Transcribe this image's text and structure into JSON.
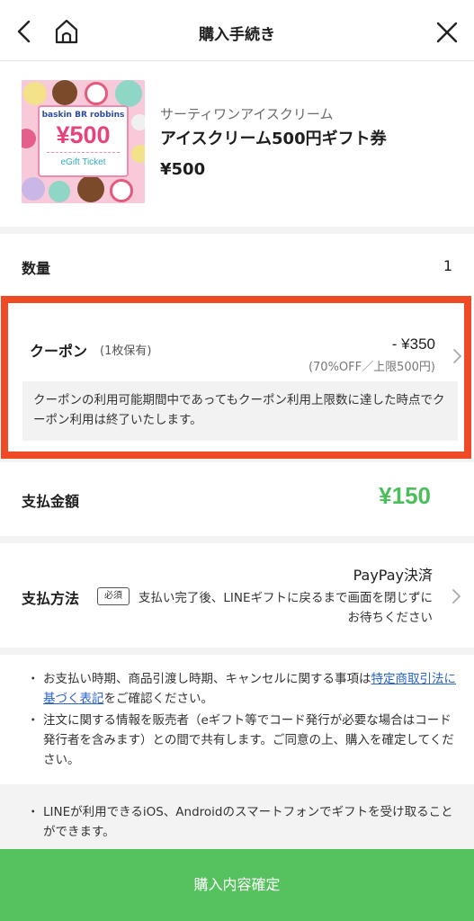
{
  "header": {
    "title": "購入手続き",
    "back_icon": "chevron-left",
    "home_icon": "home",
    "close_icon": "close"
  },
  "product": {
    "shop": "サーティワンアイスクリーム",
    "name": "アイスクリーム500円ギフト券",
    "price": "¥500",
    "thumbnail": {
      "brand": "baskin BR robbins",
      "price_text": "¥500",
      "label": "eGift Ticket"
    }
  },
  "quantity": {
    "label": "数量",
    "value": "1"
  },
  "coupon": {
    "label": "クーポン",
    "owned": "(1枚保有)",
    "discount": "- ¥350",
    "discount_note": "(70%OFF／上限500円)",
    "info": "クーポンの利用可能期間中であってもクーポン利用上限数に達した時点でクーポン利用は終了いたします。"
  },
  "total": {
    "label": "支払金額",
    "value": "¥150"
  },
  "payment": {
    "label": "支払方法",
    "required_badge": "必須",
    "method": "PayPay決済",
    "description": "支払い完了後、LINEギフトに戻るまで画面を閉じずにお待ちください"
  },
  "notes": {
    "bullet": "・",
    "item1_prefix": "お支払い時期、商品引渡し時期、キャンセルに関する事項は",
    "item1_link": "特定商取引法に基づく表記",
    "item1_suffix": "をご確認ください。",
    "item2": "注文に関する情報を販売者（eギフト等でコード発行が必要な場合はコード発行者を含みます）との間で共有します。ご同意の上、購入を確定してください。",
    "item3": "LINEが利用できるiOS、Androidのスマートフォンでギフトを受け取ることができます。"
  },
  "cta": {
    "label": "購入内容確定"
  },
  "colors": {
    "accent_green": "#56c25e",
    "total_green": "#4cbf5c",
    "highlight_border": "#ee4a25",
    "link": "#2a64c8"
  }
}
